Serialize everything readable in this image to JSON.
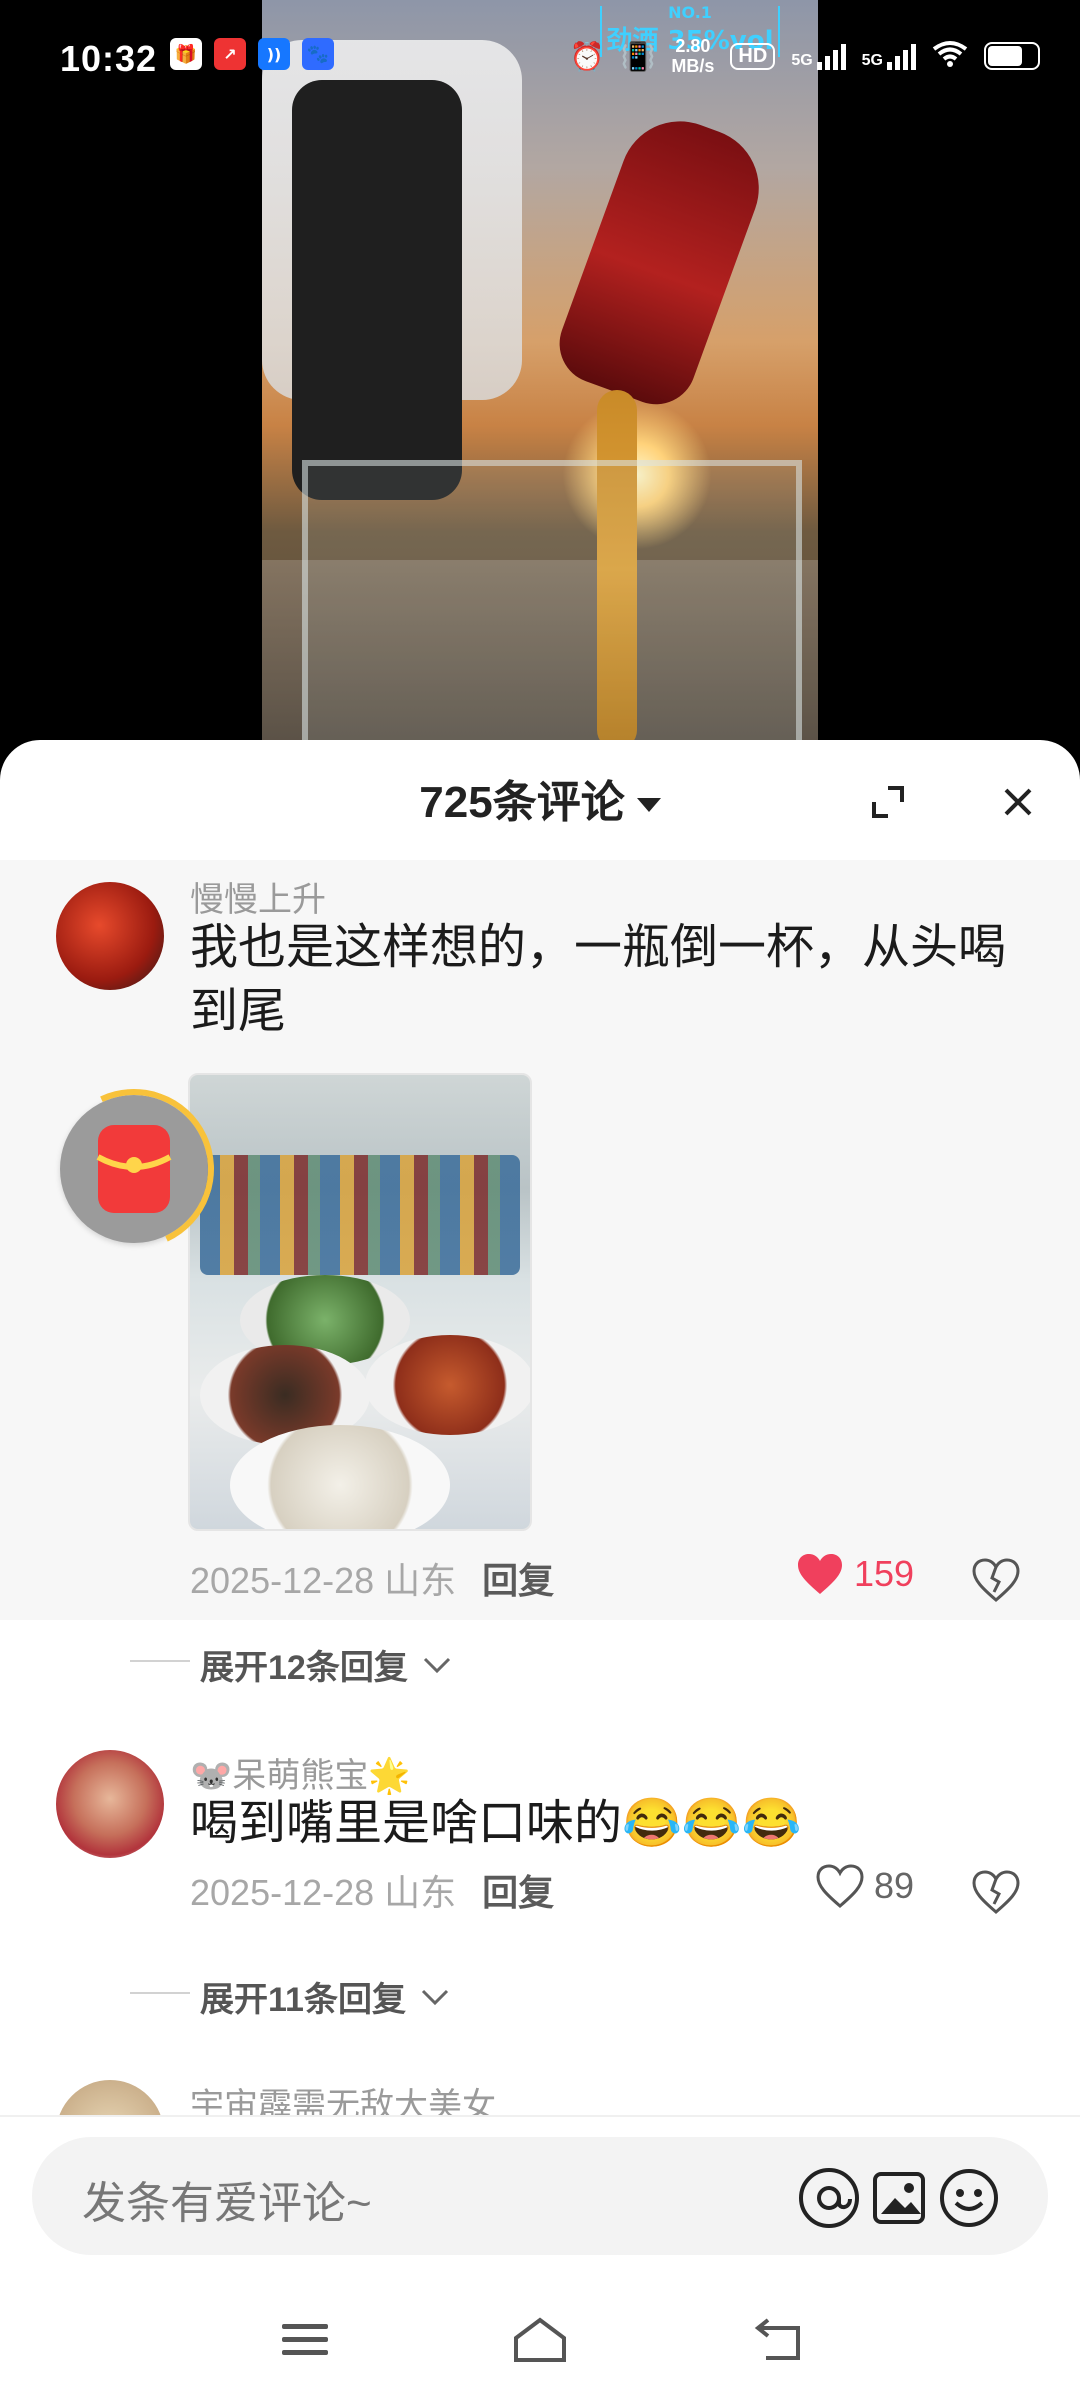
{
  "status_bar": {
    "time": "10:32",
    "net_speed_value": "2.80",
    "net_speed_unit": "MB/s",
    "hd": "HD",
    "sim1": "1",
    "sim2": "2",
    "net1": "5G",
    "net2": "5G",
    "banner_top": "NO.1",
    "banner_text": "劲酒 35%vol"
  },
  "comments_sheet": {
    "title": "725条评论",
    "expand_label": "展开",
    "close_label": "关闭"
  },
  "comments": [
    {
      "username": "慢慢上升",
      "text": "我也是这样想的，一瓶倒一杯，从头喝到尾",
      "date": "2025-12-28 山东",
      "reply_label": "回复",
      "likes": "159",
      "expand_replies": "展开12条回复"
    },
    {
      "username": "🐭呆萌熊宝🌟",
      "text": "喝到嘴里是啥口味的😂😂😂",
      "date": "2025-12-28 山东",
      "reply_label": "回复",
      "likes": "89",
      "expand_replies": "展开11条回复"
    },
    {
      "username": "宇宙霹需无敌大美女"
    }
  ],
  "composer": {
    "placeholder": "发条有爱评论~"
  },
  "colors": {
    "like_active": "#f0405d",
    "text_primary": "#1b1b1b",
    "text_secondary": "#9a9a9a"
  }
}
